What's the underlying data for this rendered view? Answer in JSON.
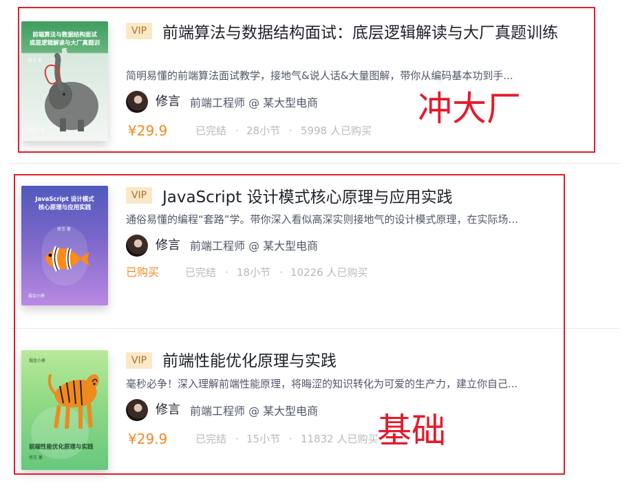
{
  "courses": [
    {
      "vip": "VIP",
      "title": "前端算法与数据结构面试：底层逻辑解读与大厂真题训练",
      "description": "简明易懂的前端算法面试教学，接地气&说人话&大量图解，带你从编码基本功到手...",
      "author": "修言",
      "job": "前端工程师 @ 某大型电商",
      "price": "¥29.9",
      "status": "已完结",
      "sections": "28小节",
      "buyers": "5998 人已购买",
      "cover": {
        "title": "前端算法与数据结构面试\n底层逻辑解读与大厂真题训练",
        "author": "修言 著",
        "brand": "掘金小册",
        "illustration": "elephant-icon"
      }
    },
    {
      "vip": "VIP",
      "title": "JavaScript 设计模式核心原理与应用实践",
      "description": "通俗易懂的编程“套路”学。带你深入看似高深实则接地气的设计模式原理，在实际场...",
      "author": "修言",
      "job": "前端工程师 @ 某大型电商",
      "bought": "已购买",
      "status": "已完结",
      "sections": "18小节",
      "buyers": "10226 人已购买",
      "cover": {
        "title": "JavaScript 设计模式\n核心原理与应用实践",
        "author": "修言 著",
        "brand": "掘金小册",
        "illustration": "clownfish-icon"
      }
    },
    {
      "vip": "VIP",
      "title": "前端性能优化原理与实践",
      "description": "毫秒必争！深入理解前端性能原理，将晦涩的知识转化为可爱的生产力，建立你自己...",
      "author": "修言",
      "job": "前端工程师 @ 某大型电商",
      "price": "¥29.9",
      "status": "已完结",
      "sections": "15小节",
      "buyers": "11832 人已购买",
      "cover": {
        "title": "前端性能优化原理与实践",
        "author": "修言 著",
        "brand": "掘金小册",
        "illustration": "tiger-icon"
      }
    }
  ],
  "annotations": {
    "top_label": "冲大厂",
    "bottom_label": "基础"
  },
  "colors": {
    "accent": "#f08a24",
    "annotation": "#e51a2b",
    "vip_bg": "#fbe8c6"
  }
}
